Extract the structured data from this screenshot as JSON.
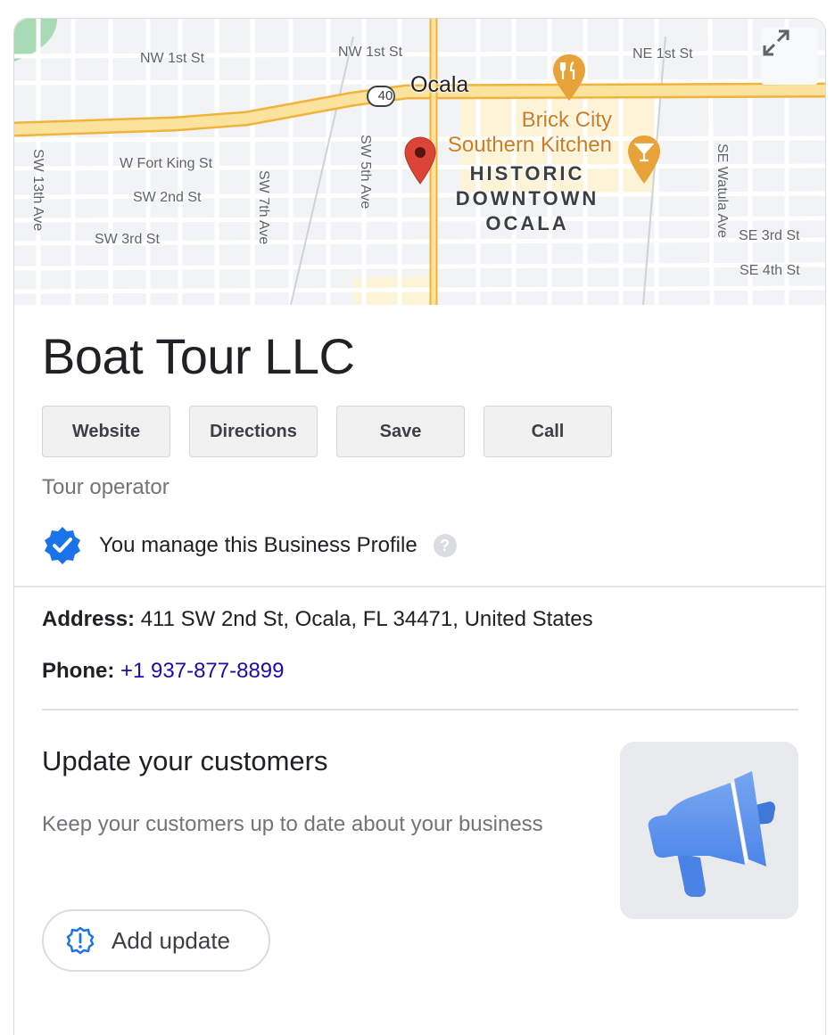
{
  "map": {
    "street_labels": {
      "nw1st_left": "NW 1st St",
      "nw1st_right": "NW 1st St",
      "ne1st": "NE 1st St",
      "fort_king": "W Fort King St",
      "sw2nd": "SW 2nd St",
      "sw3rd": "SW 3rd St",
      "sw13th": "SW 13th Ave",
      "sw7th": "SW 7th Ave",
      "sw5th": "SW 5th Ave",
      "watula": "SE Watula Ave",
      "se3rd": "SE 3rd St",
      "se4th": "SE 4th St"
    },
    "route_shield": "40",
    "city_label": "Ocala",
    "poi_label_line1": "Brick City",
    "poi_label_line2": "Southern Kitchen",
    "district_line1": "HISTORIC",
    "district_line2": "DOWNTOWN",
    "district_line3": "OCALA",
    "icons": {
      "expand": "expand-icon",
      "restaurant_pin": "restaurant-pin-icon",
      "bar_pin": "bar-pin-icon",
      "location_pin": "location-pin-icon"
    },
    "colors": {
      "background": "#f1f3f4",
      "road": "#ffffff",
      "highway_fill": "#fbe29d",
      "highway_edge": "#f2b33d",
      "park": "#a8dab5",
      "poi": "#e8a23a",
      "pin": "#db4437"
    }
  },
  "business": {
    "name": "Boat Tour LLC",
    "category": "Tour operator",
    "managed_text": "You manage this Business Profile",
    "help_glyph": "?",
    "address_label": "Address:",
    "address_value": " 411 SW 2nd St, Ocala, FL 34471, United States",
    "phone_label": "Phone:",
    "phone_value": "+1 937-877-8899"
  },
  "actions": {
    "website": "Website",
    "directions": "Directions",
    "save": "Save",
    "call": "Call"
  },
  "update": {
    "title": "Update your customers",
    "description": "Keep your customers up to date about your business",
    "button_label": "Add update",
    "accent": "#4285f4"
  }
}
